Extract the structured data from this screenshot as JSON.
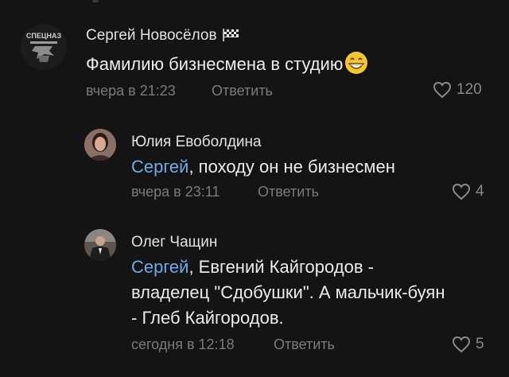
{
  "comments": [
    {
      "author": "Сергей Новосёлов",
      "avatar_text": "СПЕЦНАЗ",
      "text": "Фамилию бизнесмена в студию",
      "time": "вчера в 21:23",
      "reply_label": "Ответить",
      "likes": "120",
      "badge": "checkered-flag-icon",
      "emoji": "grinning-face-icon"
    },
    {
      "author": "Юлия Евоболдина",
      "mention": "Сергей",
      "text": ", походу он не бизнесмен",
      "time": "вчера в 23:11",
      "reply_label": "Ответить",
      "likes": "4"
    },
    {
      "author": "Олег Чащин",
      "mention": "Сергей",
      "text_lines": [
        ", Евгений Кайгородов -",
        "владелец \"Сдобушки\". А мальчик-буян",
        "- Глеб Кайгородов."
      ],
      "time": "сегодня в 12:18",
      "reply_label": "Ответить",
      "likes": "5"
    }
  ],
  "colors": {
    "background": "#141414",
    "mention": "#71aaeb",
    "meta": "#7b7b7b"
  }
}
